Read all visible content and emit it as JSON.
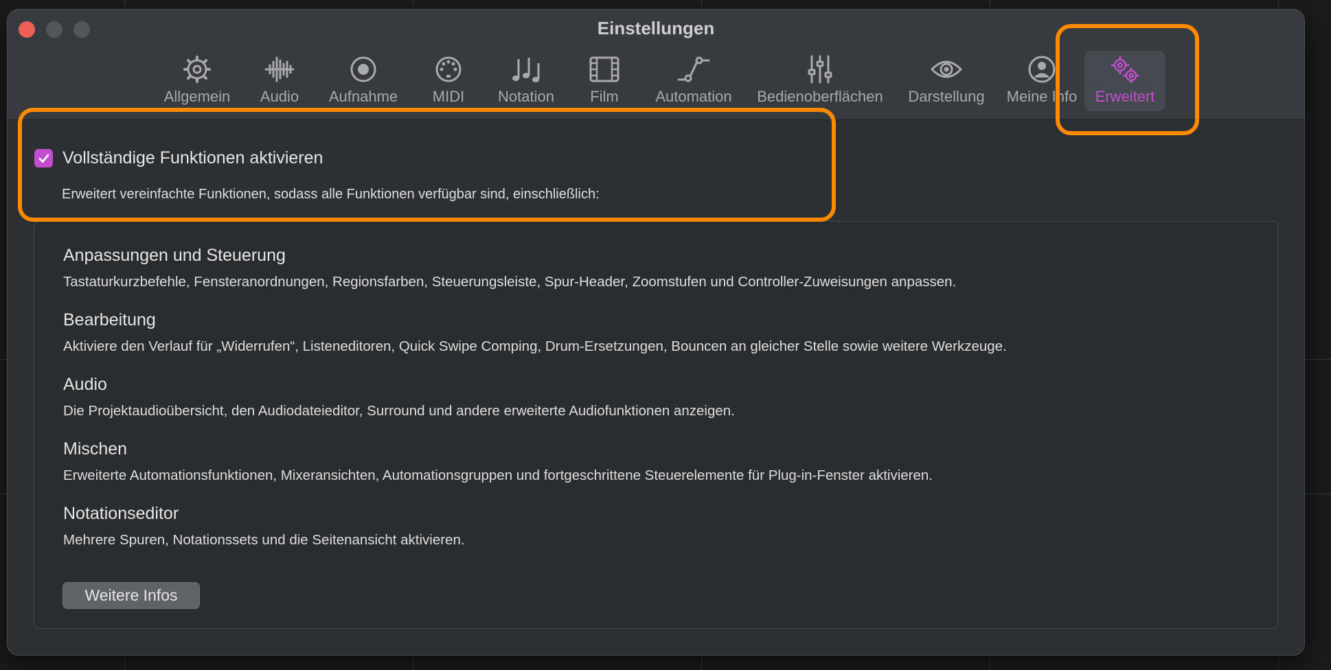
{
  "window": {
    "title": "Einstellungen"
  },
  "toolbar": {
    "items": [
      {
        "label": "Allgemein",
        "icon": "gear-icon"
      },
      {
        "label": "Audio",
        "icon": "waveform-icon"
      },
      {
        "label": "Aufnahme",
        "icon": "record-icon"
      },
      {
        "label": "MIDI",
        "icon": "midi-port-icon"
      },
      {
        "label": "Notation",
        "icon": "music-notes-icon"
      },
      {
        "label": "Film",
        "icon": "film-icon"
      },
      {
        "label": "Automation",
        "icon": "automation-curve-icon"
      },
      {
        "label": "Bedienoberflächen",
        "icon": "sliders-icon"
      },
      {
        "label": "Darstellung",
        "icon": "eye-icon"
      },
      {
        "label": "Meine Info",
        "icon": "person-icon"
      },
      {
        "label": "Erweitert",
        "icon": "gears-icon",
        "selected": true
      }
    ]
  },
  "advanced": {
    "checkbox_label": "Vollständige Funktionen aktivieren",
    "checkbox_checked": true,
    "checkbox_description": "Erweitert vereinfachte Funktionen, sodass alle Funktionen verfügbar sind, einschließlich:",
    "sections": [
      {
        "title": "Anpassungen und Steuerung",
        "description": "Tastaturkurzbefehle, Fensteranordnungen, Regionsfarben, Steuerungsleiste, Spur-Header, Zoomstufen und Controller-Zuweisungen anpassen."
      },
      {
        "title": "Bearbeitung",
        "description": "Aktiviere den Verlauf für „Widerrufen“, Listeneditoren, Quick Swipe Comping, Drum-Ersetzungen, Bouncen an gleicher Stelle sowie weitere Werkzeuge."
      },
      {
        "title": "Audio",
        "description": "Die Projektaudioübersicht, den Audiodateieditor, Surround und andere erweiterte Audiofunktionen anzeigen."
      },
      {
        "title": "Mischen",
        "description": "Erweiterte Automationsfunktionen, Mixeransichten, Automationsgruppen und fortgeschrittene Steuerelemente für Plug-in-Fenster aktivieren."
      },
      {
        "title": "Notationseditor",
        "description": "Mehrere Spuren, Notationssets und die Seitenansicht aktivieren."
      }
    ],
    "more_info_label": "Weitere Infos"
  },
  "colors": {
    "accent": "#c34ccf",
    "highlight": "#ff8a00",
    "window_bg": "#2d3033"
  }
}
